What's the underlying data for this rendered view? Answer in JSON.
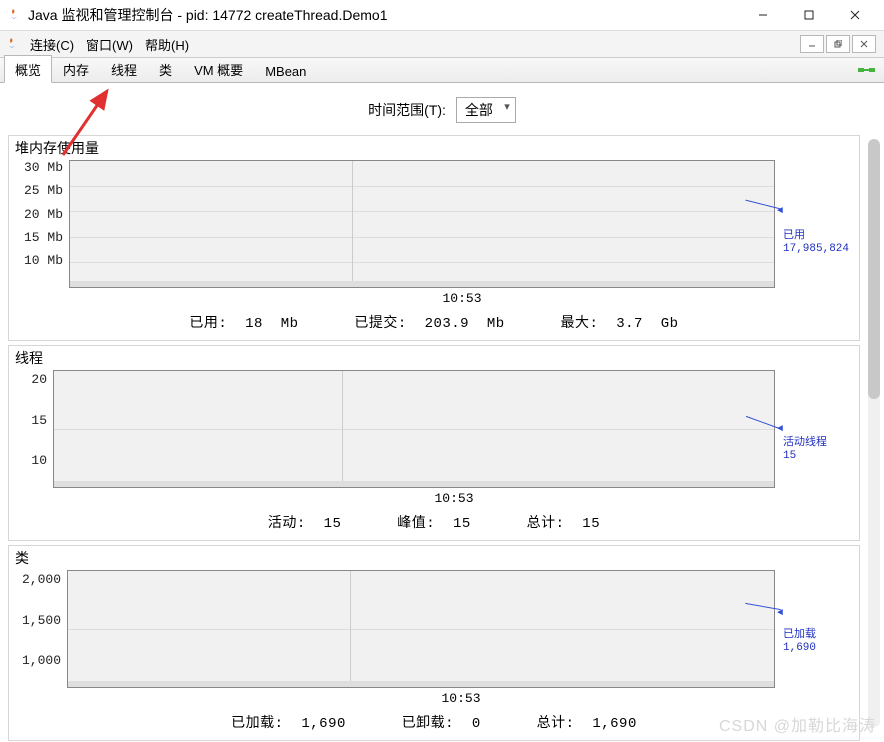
{
  "titlebar": {
    "title": "Java 监视和管理控制台 - pid: 14772 createThread.Demo1"
  },
  "menus": {
    "connect": "连接(C)",
    "window": "窗口(W)",
    "help": "帮助(H)"
  },
  "tabs": {
    "overview": "概览",
    "memory": "内存",
    "threads": "线程",
    "classes": "类",
    "vm": "VM 概要",
    "mbean": "MBean"
  },
  "timerange": {
    "label": "时间范围(T):",
    "value": "全部"
  },
  "heap": {
    "title": "堆内存使用量",
    "yticks": [
      "30 Mb",
      "25 Mb",
      "20 Mb",
      "15 Mb",
      "10 Mb"
    ],
    "xtick": "10:53",
    "legend_label": "已用",
    "legend_value": "17,985,824",
    "used_label": "已用:",
    "used_value": "18",
    "used_unit": "Mb",
    "committed_label": "已提交:",
    "committed_value": "203.9",
    "committed_unit": "Mb",
    "max_label": "最大:",
    "max_value": "3.7",
    "max_unit": "Gb"
  },
  "threads": {
    "title": "线程",
    "yticks": [
      "20",
      "15",
      "10"
    ],
    "xtick": "10:53",
    "legend_label": "活动线程",
    "legend_value": "15",
    "live_label": "活动:",
    "live_value": "15",
    "peak_label": "峰值:",
    "peak_value": "15",
    "total_label": "总计:",
    "total_value": "15"
  },
  "classes": {
    "title": "类",
    "yticks": [
      "2,000",
      "1,500",
      "1,000"
    ],
    "xtick": "10:53",
    "legend_label": "已加载",
    "legend_value": "1,690",
    "loaded_label": "已加载:",
    "loaded_value": "1,690",
    "unloaded_label": "已卸载:",
    "unloaded_value": "0",
    "total_label": "总计:",
    "total_value": "1,690"
  },
  "watermark": "CSDN @加勒比海涛",
  "chart_data": [
    {
      "type": "line",
      "title": "堆内存使用量",
      "ylabel": "Mb",
      "ylim": [
        10,
        30
      ],
      "x": [
        "10:53"
      ],
      "series": [
        {
          "name": "已用",
          "values": [
            17.985824
          ]
        }
      ],
      "stats": {
        "used_mb": 18,
        "committed_mb": 203.9,
        "max_gb": 3.7
      }
    },
    {
      "type": "line",
      "title": "线程",
      "ylabel": "",
      "ylim": [
        10,
        20
      ],
      "x": [
        "10:53"
      ],
      "series": [
        {
          "name": "活动线程",
          "values": [
            15
          ]
        }
      ],
      "stats": {
        "live": 15,
        "peak": 15,
        "total": 15
      }
    },
    {
      "type": "line",
      "title": "类",
      "ylabel": "",
      "ylim": [
        1000,
        2000
      ],
      "x": [
        "10:53"
      ],
      "series": [
        {
          "name": "已加载",
          "values": [
            1690
          ]
        }
      ],
      "stats": {
        "loaded": 1690,
        "unloaded": 0,
        "total": 1690
      }
    }
  ]
}
